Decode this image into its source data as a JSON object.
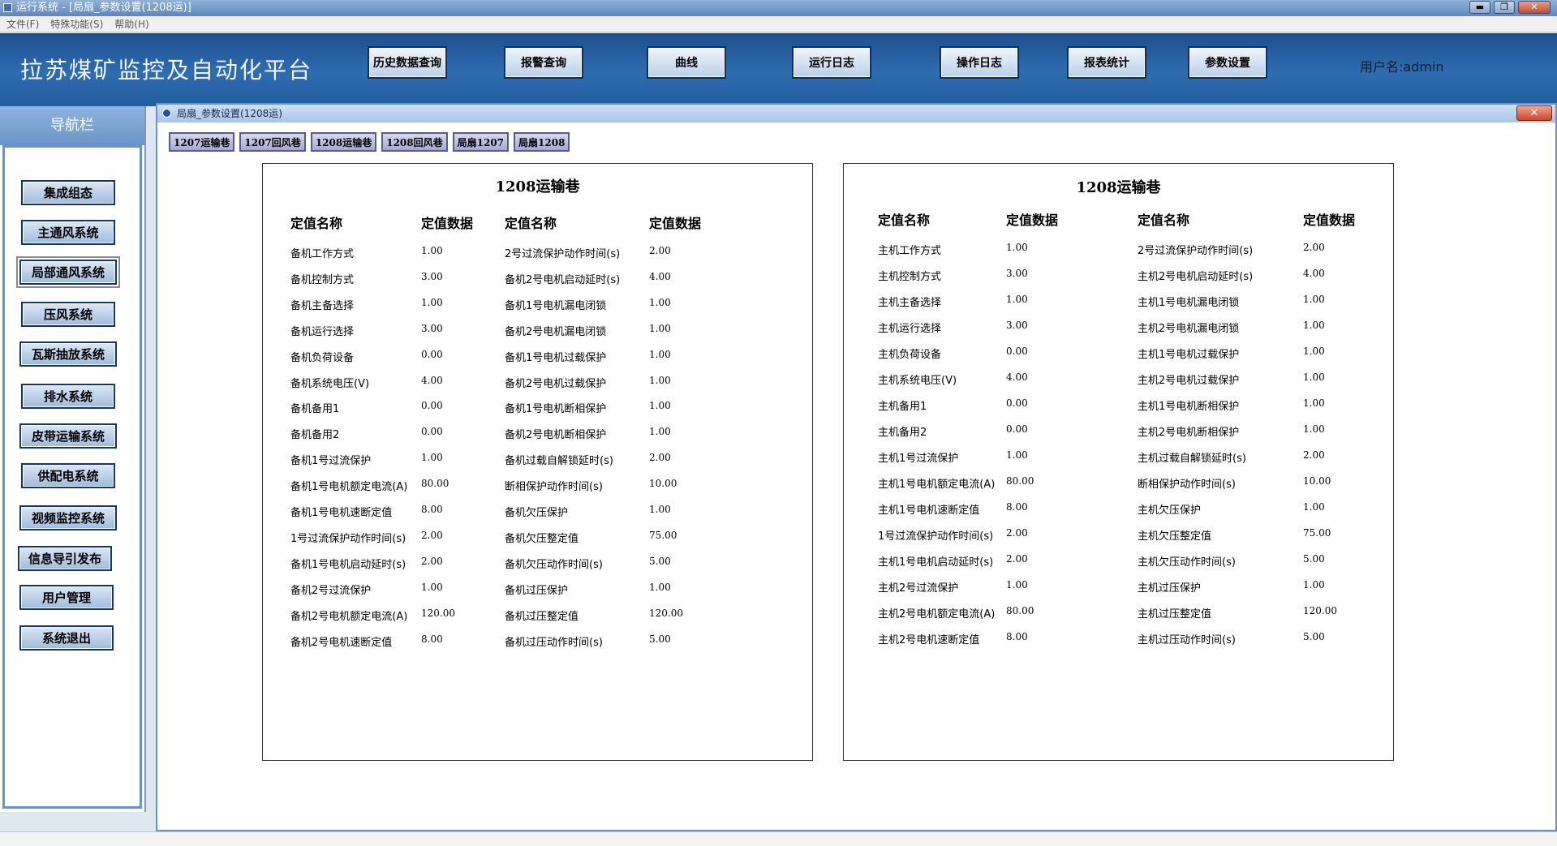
{
  "window": {
    "title": "运行系统 - [局扇_参数设置(1208运)]",
    "minimize": "▬",
    "restore": "❐",
    "close": "✕"
  },
  "menu": [
    "文件(F)",
    "特殊功能(S)",
    "帮助(H)"
  ],
  "header": {
    "brand": "拉苏煤矿监控及自动化平台",
    "buttons": [
      "历史数据查询",
      "报警查询",
      "曲线",
      "运行日志",
      "操作日志",
      "报表统计",
      "参数设置"
    ],
    "user": "用户名:admin"
  },
  "sidebar": {
    "title": "导航栏",
    "items": [
      "集成组态",
      "主通风系统",
      "局部通风系统",
      "压风系统",
      "瓦斯抽放系统",
      "排水系统",
      "皮带运输系统",
      "供配电系统",
      "视频监控系统",
      "信息导引发布",
      "用户管理",
      "系统退出"
    ],
    "active_index": 2
  },
  "main_window": {
    "title": "局扇_参数设置(1208运)",
    "close": "✕",
    "tabs": [
      "1207运输巷",
      "1207回风巷",
      "1208运输巷",
      "1208回风巷",
      "局扇1207",
      "局扇1208"
    ]
  },
  "panels": [
    {
      "title": "1208运输巷",
      "headers": [
        "定值名称",
        "定值数据",
        "定值名称",
        "定值数据"
      ],
      "rows": [
        [
          "备机工作方式",
          "1.00",
          "2号过流保护动作时间(s)",
          "2.00"
        ],
        [
          "备机控制方式",
          "3.00",
          "备机2号电机启动延时(s)",
          "4.00"
        ],
        [
          "备机主备选择",
          "1.00",
          "备机1号电机漏电闭锁",
          "1.00"
        ],
        [
          "备机运行选择",
          "3.00",
          "备机2号电机漏电闭锁",
          "1.00"
        ],
        [
          "备机负荷设备",
          "0.00",
          "备机1号电机过载保护",
          "1.00"
        ],
        [
          "备机系统电压(V)",
          "4.00",
          "备机2号电机过载保护",
          "1.00"
        ],
        [
          "备机备用1",
          "0.00",
          "备机1号电机断相保护",
          "1.00"
        ],
        [
          "备机备用2",
          "0.00",
          "备机2号电机断相保护",
          "1.00"
        ],
        [
          "备机1号过流保护",
          "1.00",
          "备机过载自解锁延时(s)",
          "2.00"
        ],
        [
          "备机1号电机额定电流(A)",
          "80.00",
          "断相保护动作时间(s)",
          "10.00"
        ],
        [
          "备机1号电机速断定值",
          "8.00",
          "备机欠压保护",
          "1.00"
        ],
        [
          "1号过流保护动作时间(s)",
          "2.00",
          "备机欠压整定值",
          "75.00"
        ],
        [
          "备机1号电机启动延时(s)",
          "2.00",
          "备机欠压动作时间(s)",
          "5.00"
        ],
        [
          "备机2号过流保护",
          "1.00",
          "备机过压保护",
          "1.00"
        ],
        [
          "备机2号电机额定电流(A)",
          "120.00",
          "备机过压整定值",
          "120.00"
        ],
        [
          "备机2号电机速断定值",
          "8.00",
          "备机过压动作时间(s)",
          "5.00"
        ]
      ]
    },
    {
      "title": "1208运输巷",
      "headers": [
        "定值名称",
        "定值数据",
        "定值名称",
        "定值数据"
      ],
      "rows": [
        [
          "主机工作方式",
          "1.00",
          "2号过流保护动作时间(s)",
          "2.00"
        ],
        [
          "主机控制方式",
          "3.00",
          "主机2号电机启动延时(s)",
          "4.00"
        ],
        [
          "主机主备选择",
          "1.00",
          "主机1号电机漏电闭锁",
          "1.00"
        ],
        [
          "主机运行选择",
          "3.00",
          "主机2号电机漏电闭锁",
          "1.00"
        ],
        [
          "主机负荷设备",
          "0.00",
          "主机1号电机过载保护",
          "1.00"
        ],
        [
          "主机系统电压(V)",
          "4.00",
          "主机2号电机过载保护",
          "1.00"
        ],
        [
          "主机备用1",
          "0.00",
          "主机1号电机断相保护",
          "1.00"
        ],
        [
          "主机备用2",
          "0.00",
          "主机2号电机断相保护",
          "1.00"
        ],
        [
          "主机1号过流保护",
          "1.00",
          "主机过载自解锁延时(s)",
          "2.00"
        ],
        [
          "主机1号电机额定电流(A)",
          "80.00",
          "断相保护动作时间(s)",
          "10.00"
        ],
        [
          "主机1号电机速断定值",
          "8.00",
          "主机欠压保护",
          "1.00"
        ],
        [
          "1号过流保护动作时间(s)",
          "2.00",
          "主机欠压整定值",
          "75.00"
        ],
        [
          "主机1号电机启动延时(s)",
          "2.00",
          "主机欠压动作时间(s)",
          "5.00"
        ],
        [
          "主机2号过流保护",
          "1.00",
          "主机过压保护",
          "1.00"
        ],
        [
          "主机2号电机额定电流(A)",
          "80.00",
          "主机过压整定值",
          "120.00"
        ],
        [
          "主机2号电机速断定值",
          "8.00",
          "主机过压动作时间(s)",
          "5.00"
        ]
      ]
    }
  ]
}
